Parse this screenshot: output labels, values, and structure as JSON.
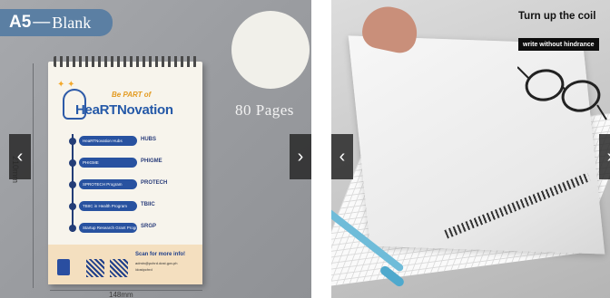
{
  "left_panel": {
    "size": "A5",
    "separator": "—",
    "kind": "Blank",
    "pages_label": "80 Pages",
    "dimension_height": "210mm",
    "dimension_width": "148mm",
    "cover": {
      "tagline": "Be PART of",
      "brand_main": "HeaRTNovation",
      "items": [
        {
          "label": "HeaRTNovation Hubs",
          "logo": "HUBS"
        },
        {
          "label": "PHIGME",
          "logo": "PHIGME"
        },
        {
          "label": "SPROTECH Program",
          "logo": "PROTECH"
        },
        {
          "label": "TBIIC in Health Program",
          "logo": "TBIIC"
        },
        {
          "label": "Startup Research Grant Program",
          "logo": "SRGP"
        }
      ],
      "scan_text": "Scan for more info!",
      "contact_email": "admin@pchrd.dost.gov.ph",
      "contact_social": "/dostpchrd"
    },
    "prev_arrow": "‹",
    "next_arrow": "›"
  },
  "right_panel": {
    "title": "Turn up the coil",
    "subtitle": "write without hindrance",
    "prev_arrow": "‹",
    "next_arrow": "›"
  },
  "colors": {
    "badge": "#5b7fa3",
    "brand_blue": "#2559a8",
    "brand_orange": "#e6901a",
    "arrow_bg": "#282828"
  }
}
